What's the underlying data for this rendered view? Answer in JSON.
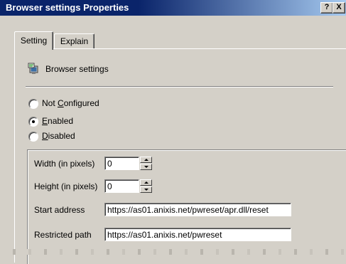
{
  "window": {
    "title": "Browser settings Properties",
    "help_button": "?",
    "close_button": "X"
  },
  "tabs": [
    {
      "label": "Setting",
      "active": true
    },
    {
      "label": "Explain",
      "active": false
    }
  ],
  "header": {
    "icon": "policy-setting-icon",
    "label": "Browser settings"
  },
  "radios": [
    {
      "pre": "Not ",
      "accel": "C",
      "post": "onfigured",
      "selected": false
    },
    {
      "pre": "",
      "accel": "E",
      "post": "nabled",
      "selected": true
    },
    {
      "pre": "",
      "accel": "D",
      "post": "isabled",
      "selected": false
    }
  ],
  "fields": {
    "width_label": "Width (in pixels)",
    "width_value": "0",
    "height_label": "Height (in pixels)",
    "height_value": "0",
    "start_label": "Start address",
    "start_value": "https://as01.anixis.net/pwreset/apr.dll/reset",
    "restricted_label": "Restricted path",
    "restricted_value": "https://as01.anixis.net/pwreset"
  },
  "colors": {
    "titlebar": "#0a246a",
    "face": "#d4d0c8",
    "title_text": "#ffffff"
  }
}
